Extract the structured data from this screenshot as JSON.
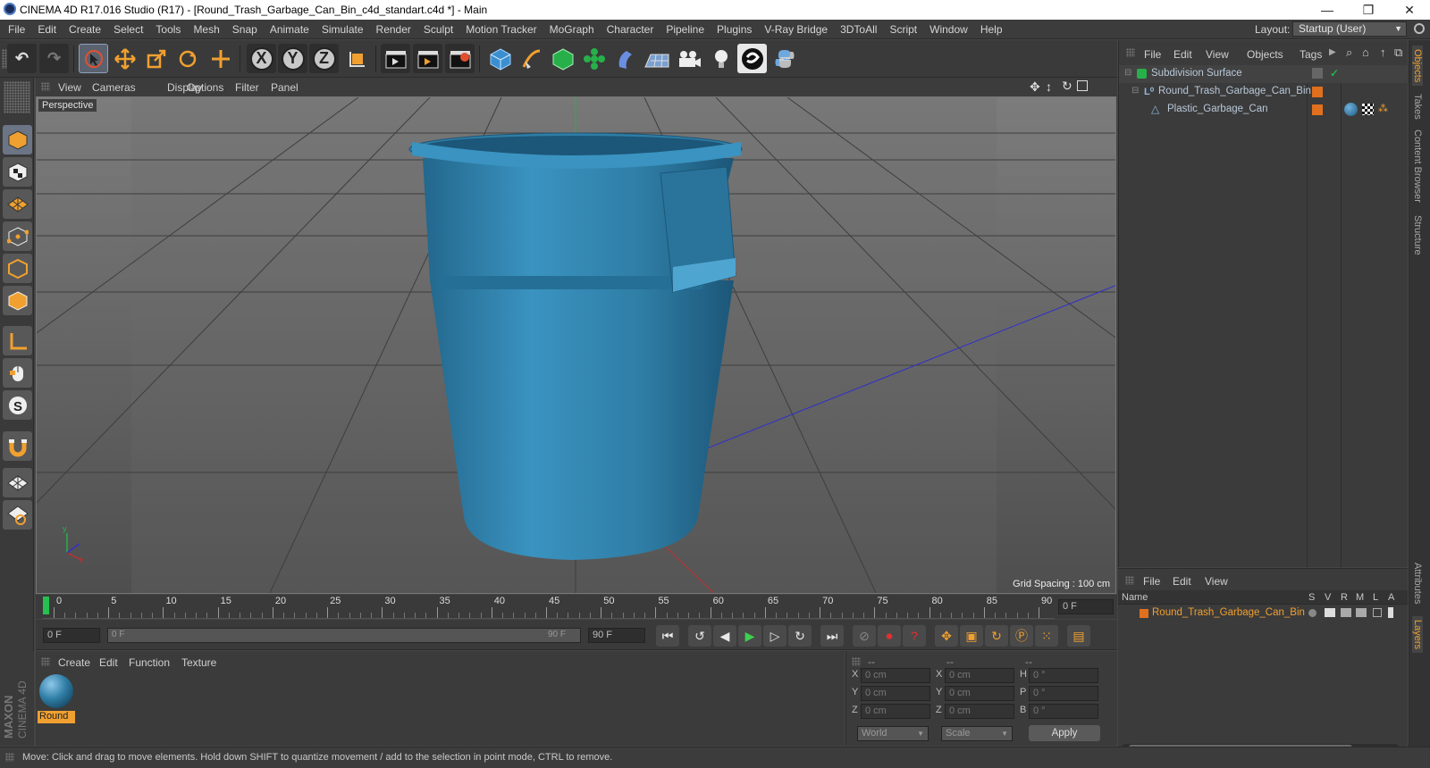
{
  "window": {
    "title": "CINEMA 4D R17.016 Studio (R17) - [Round_Trash_Garbage_Can_Bin_c4d_standart.c4d *] - Main",
    "min": "—",
    "max": "❐",
    "close": "✕"
  },
  "menu": [
    "File",
    "Edit",
    "Create",
    "Select",
    "Tools",
    "Mesh",
    "Snap",
    "Animate",
    "Simulate",
    "Render",
    "Sculpt",
    "Motion Tracker",
    "MoGraph",
    "Character",
    "Pipeline",
    "Plugins",
    "V-Ray Bridge",
    "3DToAll",
    "Script",
    "Window",
    "Help"
  ],
  "layout": {
    "label": "Layout:",
    "value": "Startup (User)"
  },
  "toolbar": {
    "undo": "↶",
    "redo": "↷",
    "x": "X",
    "y": "Y",
    "z": "Z"
  },
  "viewport": {
    "menu": [
      "View",
      "Cameras",
      "Display",
      "Options",
      "Filter",
      "Panel"
    ],
    "label": "Perspective",
    "grid_spacing": "Grid Spacing : 100 cm",
    "nav_icons": [
      "move-icon",
      "updown-icon",
      "rotate-icon",
      "maximize-icon"
    ]
  },
  "objects": {
    "menu": [
      "File",
      "Edit",
      "View",
      "Objects",
      "Tags"
    ],
    "items": [
      {
        "name": "Subdivision Surface",
        "check": "✓"
      },
      {
        "name": "Round_Trash_Garbage_Can_Bin"
      },
      {
        "name": "Plastic_Garbage_Can"
      }
    ]
  },
  "side_tabs": [
    "Objects",
    "Takes",
    "Content Browser",
    "Structure",
    "Attributes",
    "Layers"
  ],
  "layers": {
    "menu": [
      "File",
      "Edit",
      "View"
    ],
    "header": {
      "name": "Name",
      "cols": [
        "S",
        "V",
        "R",
        "M",
        "L",
        "A"
      ]
    },
    "rows": [
      {
        "name": "Round_Trash_Garbage_Can_Bin",
        "color": "#e0701e"
      }
    ]
  },
  "timeline": {
    "ticks": [
      "0",
      "5",
      "10",
      "15",
      "20",
      "25",
      "30",
      "35",
      "40",
      "45",
      "50",
      "55",
      "60",
      "65",
      "70",
      "75",
      "80",
      "85",
      "90"
    ],
    "current": "0 F"
  },
  "transport": {
    "start": "0 F",
    "slider_left": "0 F",
    "slider_right": "90 F",
    "end": "90 F"
  },
  "materials": {
    "menu": [
      "Create",
      "Edit",
      "Function",
      "Texture"
    ],
    "items": [
      {
        "name": "Round"
      }
    ]
  },
  "coords": {
    "headers": [
      "--",
      "--",
      "--"
    ],
    "rows": [
      {
        "a": "X",
        "av": "0 cm",
        "b": "X",
        "bv": "0 cm",
        "c": "H",
        "cv": "0 °"
      },
      {
        "a": "Y",
        "av": "0 cm",
        "b": "Y",
        "bv": "0 cm",
        "c": "P",
        "cv": "0 °"
      },
      {
        "a": "Z",
        "av": "0 cm",
        "b": "Z",
        "bv": "0 cm",
        "c": "B",
        "cv": "0 °"
      }
    ],
    "world": "World",
    "scale": "Scale",
    "apply": "Apply"
  },
  "logo": {
    "line1": "MAXON",
    "line2": "CINEMA 4D"
  },
  "status": "Move: Click and drag to move elements. Hold down SHIFT to quantize movement / add to the selection in point mode, CTRL to remove.",
  "colors": {
    "accent": "#f0a030",
    "can_blue": "#2f7ea6",
    "orange_tag": "#e0701e"
  }
}
